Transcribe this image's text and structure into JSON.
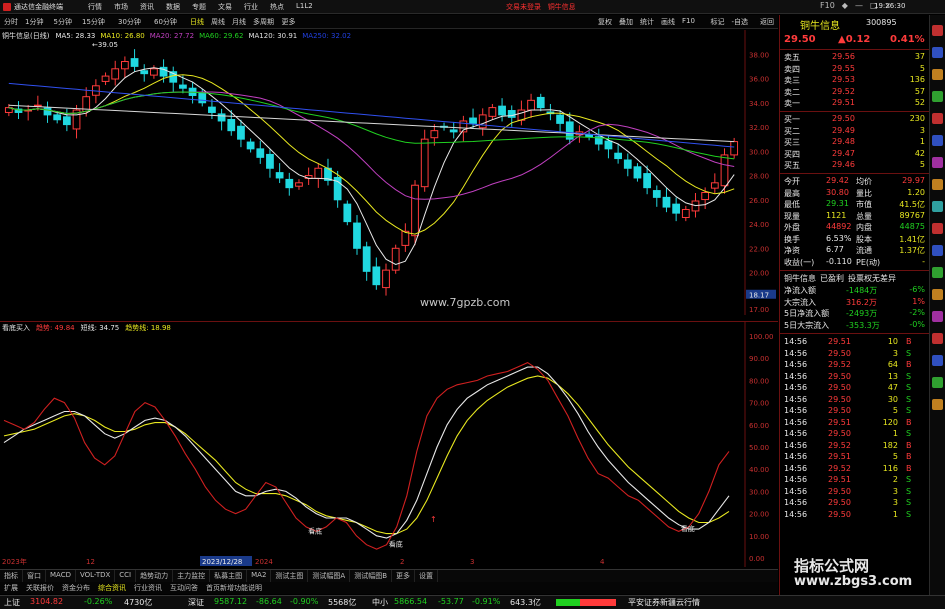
{
  "window": {
    "app_title": "通达信金融终端",
    "menu": [
      "行情",
      "市场",
      "资讯",
      "数据",
      "专题",
      "文易",
      "行业",
      "热点",
      "L1L2"
    ],
    "login_text": "交易未登录",
    "login_text2": "铜牛信息",
    "clock": "19:26:30",
    "win_controls": [
      "F10",
      "◆",
      "—",
      "□",
      "×"
    ]
  },
  "toolbar": {
    "periods": [
      "分时",
      "1分钟",
      "5分钟",
      "15分钟",
      "30分钟",
      "60分钟",
      "日线",
      "周线",
      "月线",
      "多周期",
      "更多"
    ],
    "active_period": "日线",
    "right_tools": [
      "复权",
      "叠加",
      "统计",
      "画线",
      "F10",
      "标记",
      "-自选",
      "返回"
    ]
  },
  "kline": {
    "title": "铜牛信息(日线)",
    "ma": [
      {
        "label": "MA5: 28.33",
        "color": "#e8e8e8"
      },
      {
        "label": "MA10: 26.80",
        "color": "#e8e820"
      },
      {
        "label": "MA20: 27.72",
        "color": "#c040c0"
      },
      {
        "label": "MA60: 29.62",
        "color": "#20d020"
      },
      {
        "label": "MA120: 30.91",
        "color": "#e0e0e0"
      },
      {
        "label": "MA250: 32.02",
        "color": "#2040e0"
      }
    ],
    "high_label": "39.05",
    "axis_labels": [
      "38.00",
      "36.00",
      "34.00",
      "32.00",
      "30.00",
      "28.00",
      "26.00",
      "24.00",
      "22.00",
      "20.00",
      "18.17",
      "17.00"
    ],
    "watermark": "www.7gpzb.com",
    "date_label": "2023/12/28",
    "date_axis": [
      "2023年",
      "12",
      "2024",
      "2",
      "3",
      "4"
    ],
    "closes": [
      33.6,
      33.2,
      33.4,
      33.8,
      33.0,
      32.6,
      32.2,
      33.4,
      34.5,
      35.4,
      36.2,
      36.8,
      37.4,
      37.0,
      36.4,
      36.8,
      36.2,
      35.7,
      35.2,
      34.6,
      34.0,
      33.2,
      32.5,
      31.7,
      31.0,
      30.2,
      29.5,
      28.6,
      27.8,
      27.0,
      27.4,
      28.0,
      28.6,
      27.6,
      26.0,
      24.2,
      22.0,
      20.1,
      19.0,
      20.2,
      22.0,
      23.4,
      27.2,
      31.0,
      31.7,
      32.0,
      31.6,
      32.5,
      32.3,
      33.0,
      33.6,
      33.0,
      32.8,
      33.4,
      34.2,
      33.6,
      33.1,
      32.3,
      31.0,
      31.6,
      31.2,
      30.6,
      30.2,
      29.4,
      28.6,
      27.8,
      27.0,
      26.2,
      25.4,
      24.9,
      25.2,
      25.9,
      26.6,
      27.4,
      29.7,
      30.8
    ]
  },
  "oscillator": {
    "title": "看底买入",
    "legend": [
      {
        "label": "趋势: 49.84",
        "color": "#ff3b3b"
      },
      {
        "label": "短线: 34.75",
        "color": "#e8e8e8"
      },
      {
        "label": "趋势线: 18.98",
        "color": "#e8e820"
      }
    ],
    "axis_labels": [
      "100.00",
      "90.00",
      "80.00",
      "70.00",
      "60.00",
      "50.00",
      "40.00",
      "30.00",
      "20.00",
      "10.00",
      "0.00"
    ],
    "marks": [
      "看底",
      "看底",
      "看底"
    ],
    "fast": [
      62,
      60,
      58,
      61,
      67,
      72,
      70,
      63,
      52,
      45,
      42,
      46,
      56,
      66,
      70,
      68,
      62,
      55,
      47,
      40,
      32,
      26,
      22,
      20,
      22,
      28,
      34,
      32,
      25,
      18,
      14,
      12,
      14,
      18,
      16,
      10,
      6,
      4,
      6,
      14,
      28,
      48,
      64,
      72,
      76,
      78,
      79,
      80,
      82,
      83,
      84,
      86,
      88,
      85,
      80,
      72,
      64,
      54,
      45,
      38,
      36,
      32,
      28,
      26,
      22,
      18,
      14,
      12,
      14,
      20,
      30,
      42,
      48
    ],
    "slow": [
      52,
      55,
      58,
      60,
      62,
      64,
      66,
      66,
      64,
      60,
      56,
      54,
      56,
      59,
      62,
      63,
      62,
      59,
      55,
      50,
      45,
      40,
      35,
      30,
      28,
      28,
      30,
      31,
      30,
      27,
      23,
      20,
      18,
      18,
      18,
      16,
      13,
      10,
      9,
      11,
      17,
      26,
      38,
      50,
      60,
      67,
      72,
      75,
      78,
      80,
      82,
      84,
      86,
      86,
      83,
      78,
      72,
      65,
      57,
      50,
      44,
      39,
      34,
      30,
      26,
      22,
      18,
      15,
      13,
      13,
      16,
      22,
      28
    ],
    "trend": [
      55,
      56,
      57,
      58,
      60,
      62,
      64,
      65,
      64,
      62,
      59,
      57,
      57,
      58,
      60,
      61,
      61,
      59,
      56,
      52,
      48,
      44,
      39,
      34,
      31,
      29,
      29,
      29,
      28,
      26,
      24,
      21,
      19,
      18,
      17,
      16,
      14,
      12,
      11,
      11,
      13,
      18,
      26,
      36,
      46,
      55,
      62,
      67,
      71,
      74,
      77,
      79,
      81,
      82,
      81,
      78,
      74,
      69,
      63,
      57,
      51,
      46,
      41,
      37,
      33,
      29,
      25,
      21,
      18,
      16,
      16,
      18,
      21
    ]
  },
  "tabs_row1": [
    "指标",
    "窗口",
    "MACD",
    "VOL-TDX",
    "CCI",
    "趋势动力",
    "主力监控",
    "私募主图",
    "MA2",
    "测试主图",
    "测试幅图A",
    "测试幅图B",
    "更多",
    "设置"
  ],
  "tabs_row2": [
    "扩展",
    "关联报价",
    "资金分布",
    "综合资讯",
    "行业资讯",
    "互动问答",
    "首页新增功能说明"
  ],
  "quote": {
    "name": "铜牛信息",
    "code": "300895",
    "price": "29.50",
    "change": "▲0.12",
    "change_pct": "0.41%",
    "asks": [
      {
        "label": "卖五",
        "price": "29.56",
        "vol": "37"
      },
      {
        "label": "卖四",
        "price": "29.55",
        "vol": "5"
      },
      {
        "label": "卖三",
        "price": "29.53",
        "vol": "136"
      },
      {
        "label": "卖二",
        "price": "29.52",
        "vol": "57"
      },
      {
        "label": "卖一",
        "price": "29.51",
        "vol": "52"
      }
    ],
    "bids": [
      {
        "label": "买一",
        "price": "29.50",
        "vol": "230"
      },
      {
        "label": "买二",
        "price": "29.49",
        "vol": "3"
      },
      {
        "label": "买三",
        "price": "29.48",
        "vol": "1"
      },
      {
        "label": "买四",
        "price": "29.47",
        "vol": "42"
      },
      {
        "label": "买五",
        "price": "29.46",
        "vol": "5"
      }
    ],
    "stats": [
      {
        "l1": "今开",
        "v1": "29.42",
        "l2": "均价",
        "v2": "29.97"
      },
      {
        "l1": "最高",
        "v1": "30.80",
        "l2": "量比",
        "v2": "1.20"
      },
      {
        "l1": "最低",
        "v1": "29.31",
        "l2": "市值",
        "v2": "41.5亿"
      },
      {
        "l1": "现量",
        "v1": "1121",
        "l2": "总量",
        "v2": "89767"
      },
      {
        "l1": "外盘",
        "v1": "44892",
        "l2": "内盘",
        "v2": "44875"
      },
      {
        "l1": "换手",
        "v1": "6.53%",
        "l2": "股本",
        "v2": "1.41亿"
      },
      {
        "l1": "净资",
        "v1": "6.77",
        "l2": "流通",
        "v2": "1.37亿"
      },
      {
        "l1": "收益(一)",
        "v1": "-0.110",
        "l2": "PE(动)",
        "v2": "-"
      }
    ],
    "info_tabs": [
      "铜牛信息",
      "已盈利",
      "投票权无差异"
    ],
    "flows": [
      {
        "label": "净流入额",
        "value": "-1484万",
        "pct": "-6%"
      },
      {
        "label": "大宗流入",
        "value": "316.2万",
        "pct": "1%"
      },
      {
        "label": "5日净流入额",
        "value": "-2493万",
        "pct": "-2%"
      },
      {
        "label": "5日大宗流入",
        "value": "-353.3万",
        "pct": "-0%"
      }
    ],
    "ticks": [
      {
        "t": "14:56",
        "p": "29.51",
        "v": "10",
        "s": "B"
      },
      {
        "t": "14:56",
        "p": "29.50",
        "v": "3",
        "s": "S"
      },
      {
        "t": "14:56",
        "p": "29.52",
        "v": "64",
        "s": "B"
      },
      {
        "t": "14:56",
        "p": "29.50",
        "v": "13",
        "s": "S"
      },
      {
        "t": "14:56",
        "p": "29.50",
        "v": "47",
        "s": "S"
      },
      {
        "t": "14:56",
        "p": "29.50",
        "v": "30",
        "s": "S"
      },
      {
        "t": "14:56",
        "p": "29.50",
        "v": "5",
        "s": "S"
      },
      {
        "t": "14:56",
        "p": "29.51",
        "v": "120",
        "s": "B"
      },
      {
        "t": "14:56",
        "p": "29.50",
        "v": "1",
        "s": "S"
      },
      {
        "t": "14:56",
        "p": "29.52",
        "v": "182",
        "s": "B"
      },
      {
        "t": "14:56",
        "p": "29.51",
        "v": "5",
        "s": "B"
      },
      {
        "t": "14:56",
        "p": "29.52",
        "v": "116",
        "s": "B"
      },
      {
        "t": "14:56",
        "p": "29.51",
        "v": "2",
        "s": "S"
      },
      {
        "t": "14:56",
        "p": "29.50",
        "v": "3",
        "s": "S"
      },
      {
        "t": "14:56",
        "p": "29.50",
        "v": "3",
        "s": "S"
      },
      {
        "t": "14:56",
        "p": "29.50",
        "v": "1",
        "s": "S"
      }
    ]
  },
  "watermark_bottom": {
    "line1": "指标公式网",
    "line2": "www.zbgs3.com"
  },
  "status": {
    "sh_name": "上证",
    "sh_val": "3104.82",
    "sh_chg": "-0.26%",
    "sh_amt": "4730亿",
    "sz_name": "深证",
    "sz_val": "9587.12",
    "sz_pts": "-86.64",
    "sz_chg": "-0.90%",
    "sz_amt": "5568亿",
    "zx_name": "中小",
    "zx_val": "5866.54",
    "zx_pts": "-53.77",
    "zx_chg": "-0.91%",
    "zx_amt": "643.3亿",
    "broker": "平安证券新疆云行情"
  }
}
